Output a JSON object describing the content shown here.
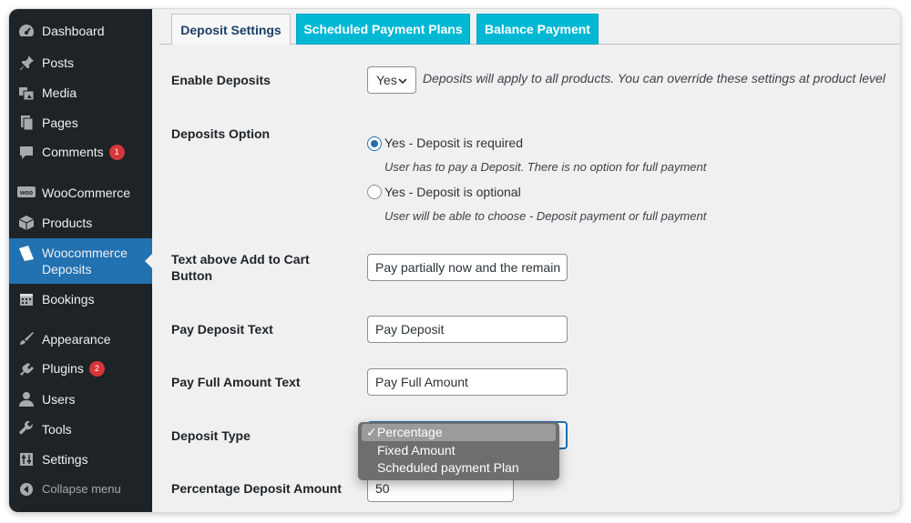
{
  "sidebar": {
    "items": [
      {
        "label": "Dashboard",
        "icon": "dashboard-icon"
      },
      {
        "label": "Posts",
        "icon": "pin-icon"
      },
      {
        "label": "Media",
        "icon": "media-icon"
      },
      {
        "label": "Pages",
        "icon": "pages-icon"
      },
      {
        "label": "Comments",
        "icon": "comment-icon",
        "badge": "1"
      },
      {
        "label": "WooCommerce",
        "icon": "woo-icon"
      },
      {
        "label": "Products",
        "icon": "box-icon"
      },
      {
        "label": "Woocommerce Deposits",
        "label_line1": "Woocommerce",
        "label_line2": "Deposits",
        "icon": "deposits-icon",
        "active": true
      },
      {
        "label": "Bookings",
        "icon": "calendar-icon"
      },
      {
        "label": "Appearance",
        "icon": "brush-icon"
      },
      {
        "label": "Plugins",
        "icon": "plug-icon",
        "badge": "2"
      },
      {
        "label": "Users",
        "icon": "user-icon"
      },
      {
        "label": "Tools",
        "icon": "wrench-icon"
      },
      {
        "label": "Settings",
        "icon": "settings-icon"
      },
      {
        "label": "Collapse menu",
        "icon": "collapse-icon"
      }
    ]
  },
  "tabs": {
    "deposit_settings": "Deposit Settings",
    "scheduled_payment_plans": "Scheduled Payment Plans",
    "balance_payment": "Balance Payment"
  },
  "form": {
    "enable_deposits": {
      "label": "Enable Deposits",
      "value": "Yes",
      "description": "Deposits will apply to all products. You can override these settings at product level"
    },
    "deposits_option": {
      "label": "Deposits Option",
      "options": [
        {
          "label": "Yes - Deposit is required",
          "description": "User has to pay a Deposit. There is no option for full payment",
          "checked": true
        },
        {
          "label": "Yes - Deposit is optional",
          "description": "User will be able to choose - Deposit payment or full payment",
          "checked": false
        }
      ]
    },
    "text_above_cart": {
      "label_line1": "Text above Add to Cart",
      "label_line2": "Button",
      "value": "Pay partially now and the remain"
    },
    "pay_deposit_text": {
      "label": "Pay Deposit Text",
      "value": "Pay Deposit"
    },
    "pay_full_amount_text": {
      "label": "Pay Full Amount Text",
      "value": "Pay Full Amount"
    },
    "deposit_type": {
      "label": "Deposit Type",
      "options": [
        "Percentage",
        "Fixed Amount",
        "Scheduled payment Plan"
      ],
      "selected": "Percentage",
      "check_mark": "✓"
    },
    "percentage_deposit_amount": {
      "label": "Percentage Deposit Amount",
      "value": "50"
    }
  },
  "colors": {
    "sidebar_bg": "#1d2327",
    "active_item": "#2271b1",
    "tab_accent": "#00b8d4",
    "badge": "#d63638"
  }
}
